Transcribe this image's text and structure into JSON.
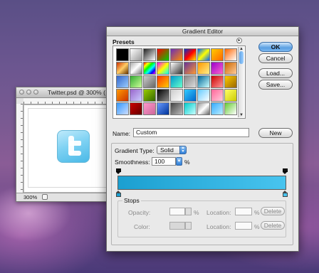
{
  "document_window": {
    "title": "Twitter.psd @ 300% (",
    "zoom": "300%",
    "icon_name": "twitter-icon"
  },
  "dialog": {
    "title": "Gradient Editor",
    "presets_label": "Presets",
    "ok_label": "OK",
    "cancel_label": "Cancel",
    "load_label": "Load...",
    "save_label": "Save...",
    "name_label": "Name:",
    "name_value": "Custom",
    "new_label": "New",
    "gradient_type_label": "Gradient Type:",
    "gradient_type_value": "Solid",
    "smoothness_label": "Smoothness:",
    "smoothness_value": "100",
    "smoothness_unit": "%",
    "stops_label": "Stops",
    "opacity_label": "Opacity:",
    "opacity_unit": "%",
    "color_label": "Color:",
    "location_label": "Location:",
    "location_unit": "%",
    "location2_label": "Location:",
    "location2_unit": "%",
    "delete_label": "Delete",
    "delete2_label": "Delete",
    "gradient_start_color": "#1b9fd0",
    "gradient_end_color": "#48c4ef",
    "accent_color": "#2f7fd8"
  },
  "presets": [
    [
      "#000000",
      "#000000"
    ],
    [
      "#ffffff",
      "#999999"
    ],
    [
      "#222222",
      "#ffffff"
    ],
    [
      "#ff0000",
      "#00cc00"
    ],
    [
      "#6a2fb8",
      "#ff8c00"
    ],
    [
      "#0033cc",
      "#ff0000",
      "#ffee00"
    ],
    [
      "#0066ff",
      "#ffff00",
      "#0066ff"
    ],
    [
      "#ffcc00",
      "#ff6600"
    ],
    [
      "#ff6600",
      "#ffffff"
    ],
    [
      "#cc3300",
      "#ffcc66",
      "#663300"
    ],
    [
      "#aaaaaa",
      "#ffffff",
      "#777777"
    ],
    [
      "#ff0000",
      "#ffff00",
      "#00ff00",
      "#00ffff",
      "#0000ff",
      "#ff00ff"
    ],
    [
      "#ff00ff",
      "#ffff00",
      "#00ffff"
    ],
    [
      "#ffffff",
      "#333333"
    ],
    [
      "#663399",
      "#ff9933"
    ],
    [
      "#ff9900",
      "#ffee88"
    ],
    [
      "#9900cc",
      "#ff66cc"
    ],
    [
      "#cc6600",
      "#ffcc99"
    ],
    [
      "#3366cc",
      "#99ccff"
    ],
    [
      "#33aa33",
      "#ccff99"
    ],
    [
      "#cccccc",
      "#666666"
    ],
    [
      "#ff3300",
      "#ffcc00"
    ],
    [
      "#0099cc",
      "#66ffcc"
    ],
    [
      "#888888",
      "#dddddd"
    ],
    [
      "#006699",
      "#ccffff"
    ],
    [
      "#cc0000",
      "#ff9999"
    ],
    [
      "#ffcc00",
      "#996600"
    ],
    [
      "#ff9900",
      "#cc3300"
    ],
    [
      "#9966cc",
      "#ccccff"
    ],
    [
      "#99cc00",
      "#336600"
    ],
    [
      "#000000",
      "#888888"
    ],
    [
      "#cccccc",
      "#ffffff"
    ],
    [
      "#33ccff",
      "#0066cc"
    ],
    [
      "#66ccff",
      "#ffffff"
    ],
    [
      "#ff6699",
      "#ffccdd"
    ],
    [
      "#ffff66",
      "#cccc00"
    ],
    [
      "#3399ff",
      "#ccddff"
    ],
    [
      "#cc0000",
      "#660000"
    ],
    [
      "#ff99cc",
      "#cc6699"
    ],
    [
      "#6699ff",
      "#003399"
    ],
    [
      "#444444",
      "#bbbbbb"
    ],
    [
      "#00cccc",
      "#ccffff"
    ],
    [
      "#999999",
      "#ffffff",
      "#666666"
    ],
    [
      "#33aaff",
      "#bbeeff"
    ],
    [
      "#66cc33",
      "#ffffff"
    ]
  ]
}
